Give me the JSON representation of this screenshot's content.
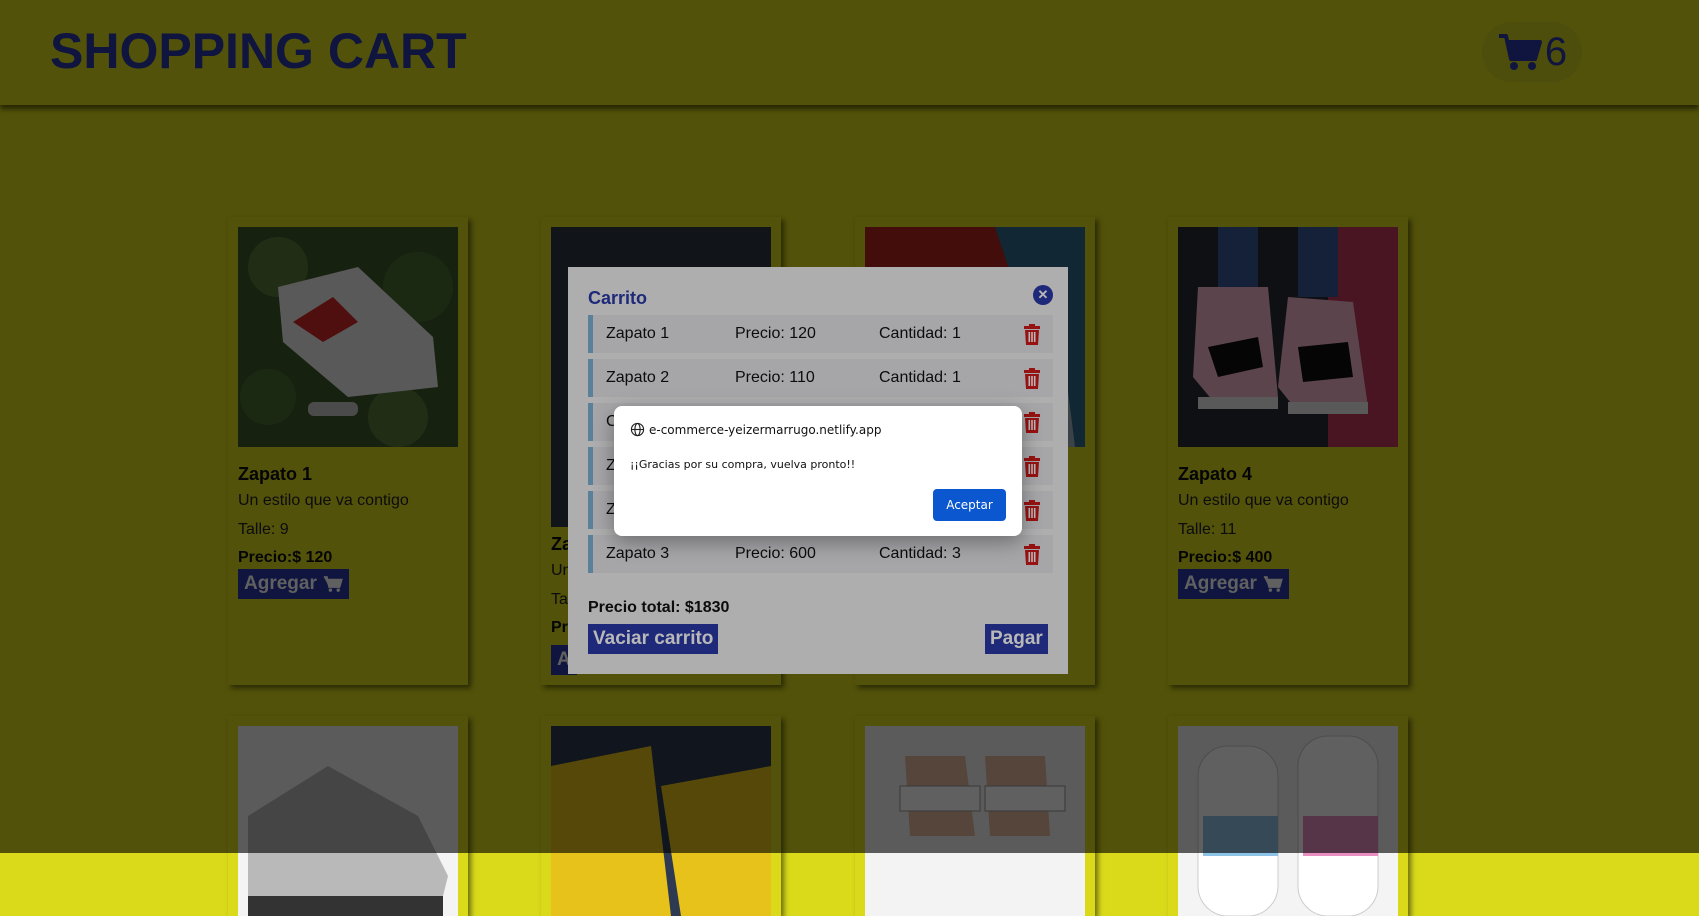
{
  "header": {
    "title": "SHOPPING CART",
    "cart_count": "6"
  },
  "products": [
    {
      "name": "Zapato 1",
      "description": "Un estilo que va contigo",
      "size": "Talle: 9",
      "price": "Precio:$ 120",
      "button": "Agregar"
    },
    {
      "name": "Za",
      "description": "Un",
      "size": "Ta",
      "price": "Pr",
      "button": "A"
    },
    {
      "name": "Zapato 4",
      "description": "Un estilo que va contigo",
      "size": "Talle: 11",
      "price": "Precio:$ 400",
      "button": "Agregar"
    }
  ],
  "cart_modal": {
    "title": "Carrito",
    "items": [
      {
        "name": "Zapato 1",
        "price": "Precio: 120",
        "qty": "Cantidad: 1"
      },
      {
        "name": "Zapato 2",
        "price": "Precio: 110",
        "qty": "Cantidad: 1"
      },
      {
        "name": "C",
        "price": "",
        "qty": ""
      },
      {
        "name": "Z",
        "price": "",
        "qty": ""
      },
      {
        "name": "Z",
        "price": "",
        "qty": ""
      },
      {
        "name": "Zapato 3",
        "price": "Precio: 600",
        "qty": "Cantidad: 3"
      }
    ],
    "total": "Precio total: $1830",
    "empty_button": "Vaciar carrito",
    "pay_button": "Pagar"
  },
  "alert": {
    "origin": "e-commerce-yeizermarrugo.netlify.app",
    "message": "¡¡Gracias por su compra, vuelva pronto!!",
    "ok_button": "Aceptar"
  },
  "colors": {
    "page_bg": "#dada1b",
    "brand_blue": "#2a3aa8",
    "delete_red": "#d11a1a",
    "alert_button": "#0b57d0"
  },
  "icons": {
    "cart": "shopping-cart-icon",
    "close": "close-circle-icon",
    "delete": "trash-icon",
    "origin": "globe-icon"
  }
}
